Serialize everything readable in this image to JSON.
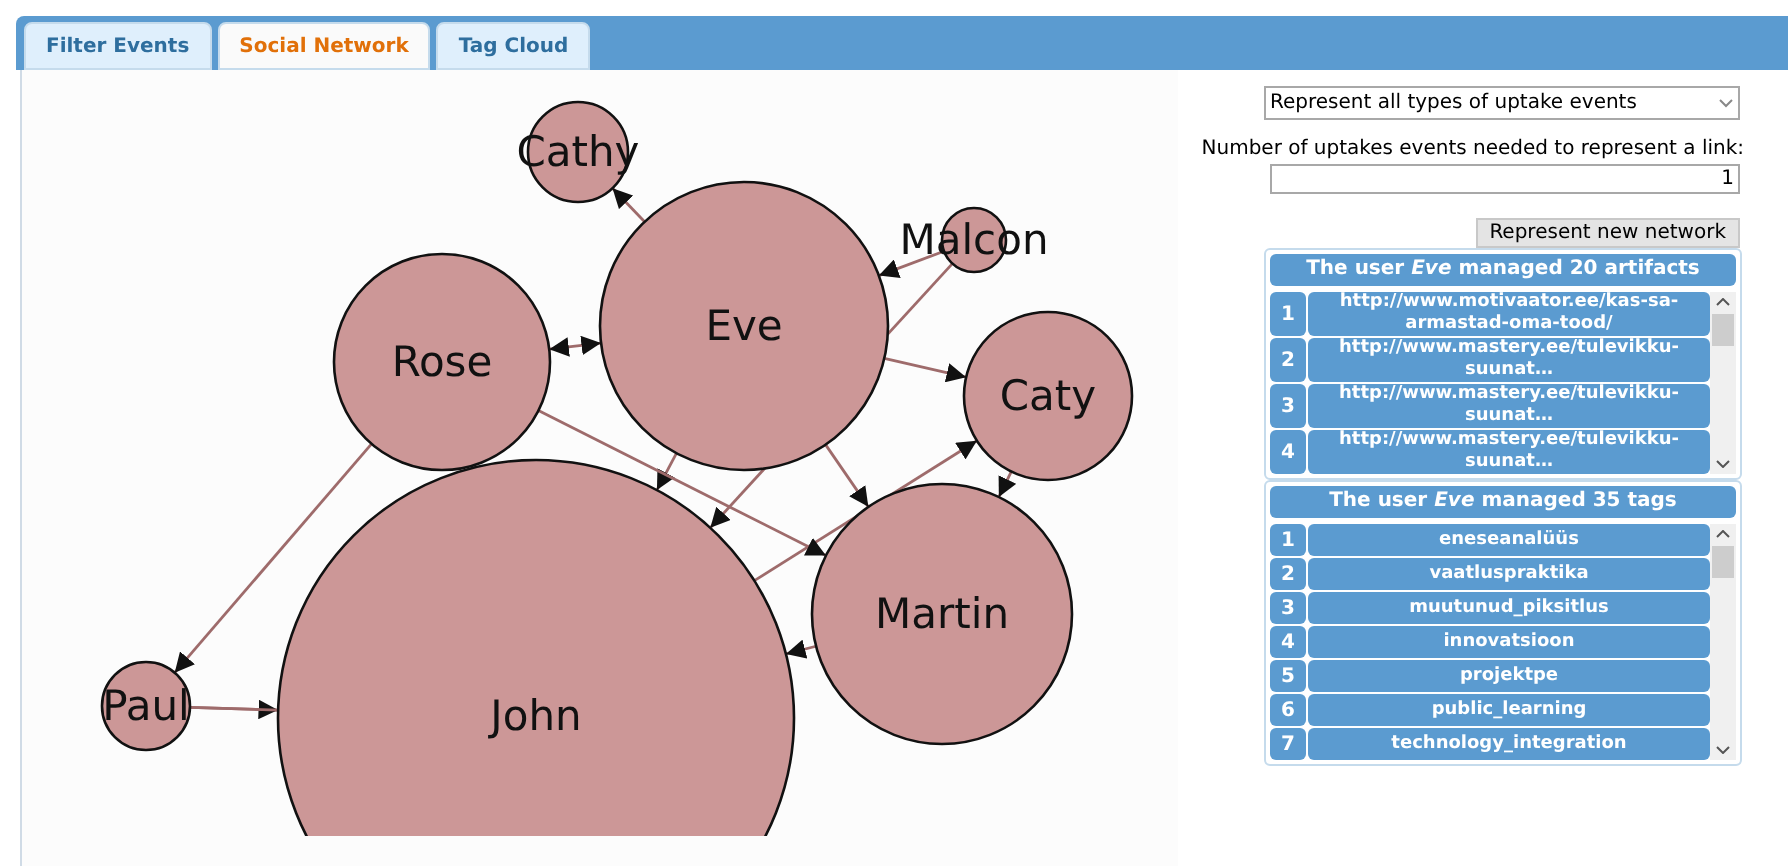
{
  "tabs": [
    {
      "label": "Filter Events",
      "selected": false
    },
    {
      "label": "Social Network",
      "selected": true
    },
    {
      "label": "Tag Cloud",
      "selected": false
    }
  ],
  "network": {
    "nodes": [
      {
        "name": "Cathy"
      },
      {
        "name": "Eve"
      },
      {
        "name": "Malcon"
      },
      {
        "name": "Rose"
      },
      {
        "name": "Caty"
      },
      {
        "name": "Martin"
      },
      {
        "name": "Paul"
      },
      {
        "name": "John"
      }
    ]
  },
  "controls": {
    "event_type": {
      "value": "Represent all types of uptake events"
    },
    "threshold": {
      "label": "Number of uptakes events needed to represent a link:",
      "value": "1"
    },
    "button": "Represent new network"
  },
  "artifacts": {
    "title": "The user *Eve* managed 20 artifacts",
    "items": [
      {
        "number": "1",
        "text": "http://www.motivaator.ee/kas-sa-armastad-oma-tood/"
      },
      {
        "number": "2",
        "text": "http://www.mastery.ee/tulevikku-suunat…"
      },
      {
        "number": "3",
        "text": "http://www.mastery.ee/tulevikku-suunat…"
      },
      {
        "number": "4",
        "text": "http://www.mastery.ee/tulevikku-suunat…"
      }
    ]
  },
  "tags": {
    "title": "The user *Eve* managed 35 tags",
    "items": [
      {
        "number": "1",
        "text": "eneseanalüüs"
      },
      {
        "number": "2",
        "text": "vaatluspraktika"
      },
      {
        "number": "3",
        "text": "muutunud_piksitlus"
      },
      {
        "number": "4",
        "text": "innovatsioon"
      },
      {
        "number": "5",
        "text": "projektpe"
      },
      {
        "number": "6",
        "text": "public_learning"
      },
      {
        "number": "7",
        "text": "technology_integration"
      }
    ]
  }
}
